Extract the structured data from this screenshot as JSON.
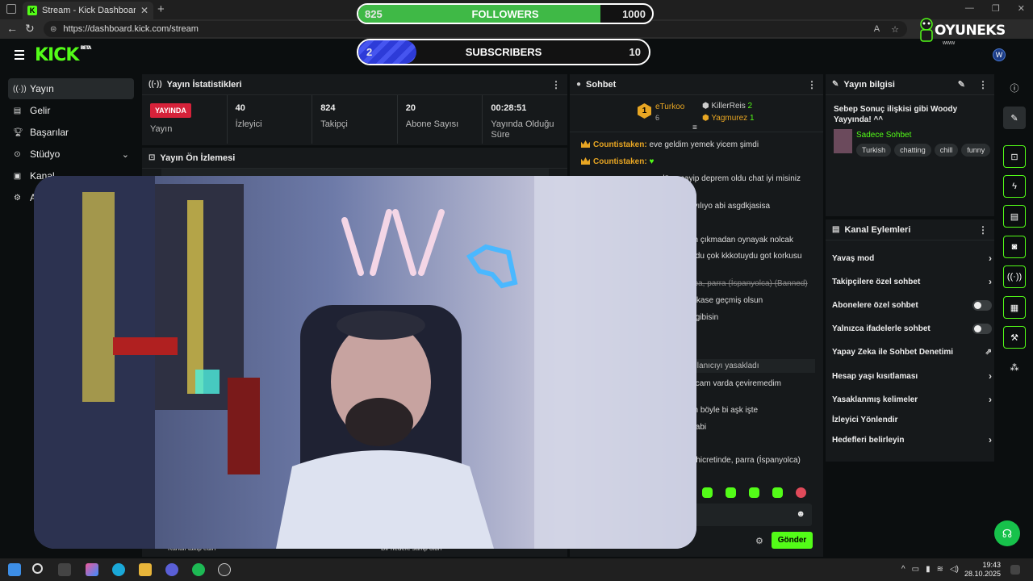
{
  "browser": {
    "tab_title": "Stream - Kick Dashboard",
    "url": "https://dashboard.kick.com/stream"
  },
  "overlay": {
    "followers": {
      "label": "FOLLOWERS",
      "current": "825",
      "goal": "1000",
      "progress": 0.825
    },
    "subscribers": {
      "label": "SUBSCRIBERS",
      "current": "2",
      "goal": "10",
      "progress": 0.2
    },
    "brand": "OYUNEKS",
    "brand_sub": "www"
  },
  "sidebar": {
    "items": [
      {
        "label": "Yayın",
        "icon": "broadcast-icon"
      },
      {
        "label": "Gelir",
        "icon": "revenue-icon"
      },
      {
        "label": "Başarılar",
        "icon": "trophy-icon"
      },
      {
        "label": "Stüdyo",
        "icon": "studio-icon"
      },
      {
        "label": "Kanal",
        "icon": "channel-icon"
      },
      {
        "label": "A",
        "icon": "settings-icon"
      }
    ]
  },
  "stats": {
    "title": "Yayın İstatistikleri",
    "live_badge": "YAYINDA",
    "live_label": "Yayın",
    "items": [
      {
        "value": "40",
        "label": "İzleyici"
      },
      {
        "value": "824",
        "label": "Takipçi"
      },
      {
        "value": "20",
        "label": "Abone Sayısı"
      },
      {
        "value": "00:28:51",
        "label": "Yayında Olduğu Süre"
      }
    ]
  },
  "preview": {
    "title": "Yayın Ön İzlemesi",
    "bottom_left": "Kanalı takip edin",
    "bottom_mid": "Bir hedefe sahip olun"
  },
  "chat": {
    "title": "Sohbet",
    "top_gifter": {
      "rank": "1",
      "name": "eTurkoo",
      "count": "6"
    },
    "gifters": [
      {
        "name": "KillerReis",
        "count": "2"
      },
      {
        "name": "Yagmurez",
        "count": "1"
      }
    ],
    "messages": [
      {
        "user": "Countistaken:",
        "text": " eve geldim yemek yicem şimdi"
      },
      {
        "user": "Countistaken:",
        "text": " ♥"
      },
      {
        "user": "",
        "text": "dün acayip deprem oldu chat iyi misiniz"
      },
      {
        "user": "",
        "text": "ayılıyo abi asgdkjasisa"
      },
      {
        "user": "",
        "text": "en çıkmadan oynayak nolcak"
      },
      {
        "user": "",
        "text": "oldu çok kkkotuydu got korkusu"
      },
      {
        "user": "",
        "text": "epa, parra (İspanyolca) (Banned)"
      },
      {
        "user": "",
        "text": "erkase geçmiş olsun"
      },
      {
        "user": "",
        "text": "ş gibisin"
      },
      {
        "user": "",
        "text": "ullanıcıyı yasakladı"
      },
      {
        "user": "",
        "text": "olcam varda çeviremedim"
      },
      {
        "user": "",
        "text": "ım böyle bi aşk işte"
      },
      {
        "user": "",
        "text": "s abi"
      },
      {
        "user": "",
        "text": "n hicretinde, parra (İspanyolca)"
      }
    ],
    "send_label": "Gönder"
  },
  "info": {
    "title": "Yayın bilgisi",
    "stream_title": "Sebep Sonuç ilişkisi gibi Woody Yayyında! ^^",
    "category": "Sadece Sohbet",
    "tags": [
      "Turkish",
      "chatting",
      "chill",
      "funny"
    ]
  },
  "actions": {
    "title": "Kanal Eylemleri",
    "items": [
      {
        "label": "Yavaş mod",
        "control": "chevron"
      },
      {
        "label": "Takipçilere özel sohbet",
        "control": "chevron"
      },
      {
        "label": "Abonelere özel sohbet",
        "control": "toggle"
      },
      {
        "label": "Yalnızca ifadelerle sohbet",
        "control": "toggle"
      },
      {
        "label": "Yapay Zeka ile Sohbet Denetimi",
        "control": "external"
      },
      {
        "label": "Hesap yaşı kısıtlaması",
        "control": "chevron"
      },
      {
        "label": "Yasaklanmış kelimeler",
        "control": "chevron"
      },
      {
        "label": "İzleyici Yönlendir",
        "control": "none"
      },
      {
        "label": "Hedefleri belirleyin",
        "control": "chevron"
      }
    ]
  },
  "taskbar": {
    "time": "19:43",
    "date": "28.10.2025"
  },
  "colors": {
    "kick_green": "#53fc18",
    "live_red": "#d6223a",
    "gifter_gold": "#e8a623"
  }
}
